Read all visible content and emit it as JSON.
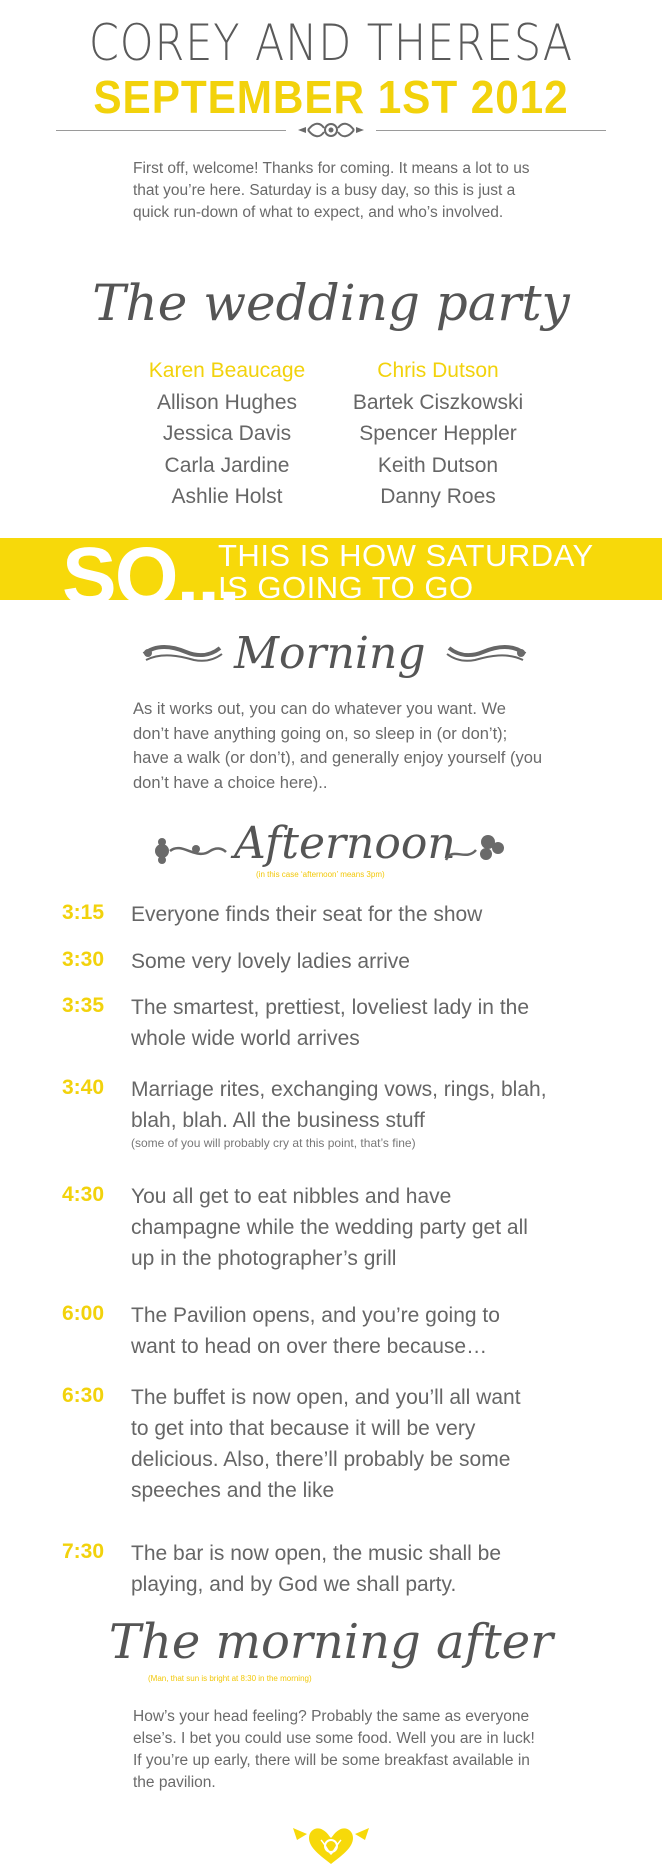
{
  "header": {
    "names": "COREY AND THERESA",
    "date": "SEPTEMBER 1ST 2012"
  },
  "intro": "First off, welcome! Thanks for coming. It means a lot to us that you’re here. Saturday is a busy day, so this is just a quick run-down of what to expect, and who’s involved.",
  "wedding_party": {
    "title": "The wedding party",
    "left": [
      "Karen Beaucage",
      "Allison Hughes",
      "Jessica Davis",
      "Carla Jardine",
      "Ashlie Holst"
    ],
    "right": [
      "Chris Dutson",
      "Bartek Ciszkowski",
      "Spencer Heppler",
      "Keith Dutson",
      "Danny Roes"
    ]
  },
  "banner": {
    "so": "SO...",
    "line1": "THIS IS HOW SATURDAY",
    "line2": "IS GOING TO GO"
  },
  "morning": {
    "title": "Morning",
    "text": "As it works out, you can do whatever you want. We don’t have anything going on, so sleep in (or don’t); have a walk (or don’t), and generally enjoy yourself (you don’t have a choice here).."
  },
  "afternoon": {
    "title": "Afternoon",
    "note": "(in this case ‘afternoon’ means 3pm)"
  },
  "schedule": [
    {
      "time": "3:15",
      "text": "Everyone finds their seat for the show",
      "note": ""
    },
    {
      "time": "3:30",
      "text": "Some very lovely ladies arrive",
      "note": ""
    },
    {
      "time": "3:35",
      "text": "The smartest, prettiest, loveliest lady in the whole wide world arrives",
      "note": ""
    },
    {
      "time": "3:40",
      "text": "Marriage rites, exchanging vows, rings, blah, blah, blah. All the business stuff",
      "note": "(some of you will probably cry at this point, that’s fine)"
    },
    {
      "time": "4:30",
      "text": "You all get to eat nibbles and have champagne while the wedding party get all up in the photographer’s grill",
      "note": ""
    },
    {
      "time": "6:00",
      "text": "The Pavilion opens, and you’re going to want to head on over there because…",
      "note": ""
    },
    {
      "time": "6:30",
      "text": "The buffet is now open, and you’ll all want to get into that because it will be very delicious. Also, there’ll probably be some speeches and the like",
      "note": ""
    },
    {
      "time": "7:30",
      "text": "The bar is now open, the music shall be playing, and by God we shall party.",
      "note": ""
    }
  ],
  "morning_after": {
    "title": "The morning after",
    "note": "(Man, that sun is bright at 8:30 in the morning)",
    "text": "How’s your head feeling? Probably the same as everyone else’s. I bet you could use some food. Well you are in luck! If you’re up early, there will be some breakfast available in the pavilion."
  },
  "colors": {
    "accent": "#f2d20c",
    "banner": "#f7d90a",
    "text": "#666666"
  },
  "icons": [
    "flourish-divider-icon",
    "scroll-flourish-icon",
    "floral-ornament-icon",
    "heart-filigree-icon"
  ]
}
